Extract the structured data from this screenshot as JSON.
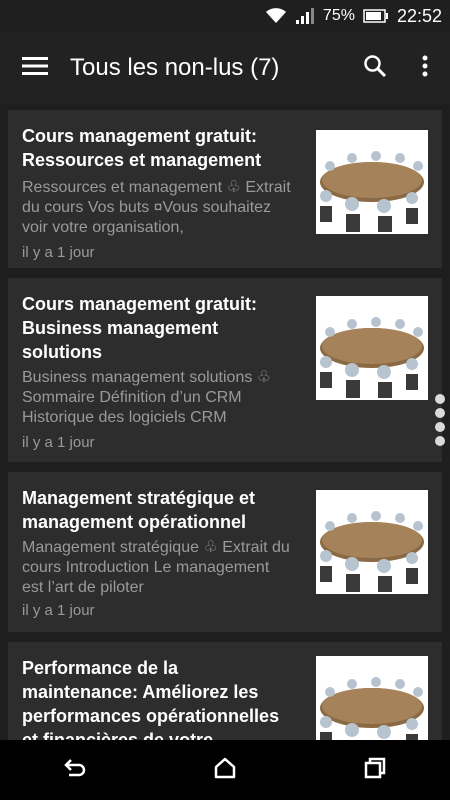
{
  "status": {
    "battery_percent": "75%",
    "time": "22:52",
    "icons": [
      "wifi-icon",
      "signal-icon",
      "battery-icon"
    ]
  },
  "appbar": {
    "title": "Tous les non-lus (7)",
    "icons": [
      "menu-icon",
      "search-icon",
      "more-vert-icon"
    ]
  },
  "articles": [
    {
      "title": "Cours management gratuit: Ressources et management",
      "excerpt": "Ressources et management ♧ Extrait du cours Vos buts ¤Vous souhaitez voir votre organisation,",
      "time": "il y a 1 jour"
    },
    {
      "title": "Cours management gratuit: Business management solutions",
      "excerpt": "Business management solutions ♧ Sommaire Définition d’un CRM Historique des logiciels CRM",
      "time": "il y a 1 jour"
    },
    {
      "title": "Management stratégique et management opérationnel",
      "excerpt": "Management stratégique ♧ Extrait du cours Introduction Le management est l’art de piloter",
      "time": "il y a 1 jour"
    },
    {
      "title": "Performance de la maintenance: Améliorez les performances opérationnelles et financières de votre",
      "excerpt": "",
      "time": ""
    }
  ],
  "navbar": {
    "icons": [
      "back-icon",
      "home-icon",
      "recents-icon"
    ]
  }
}
